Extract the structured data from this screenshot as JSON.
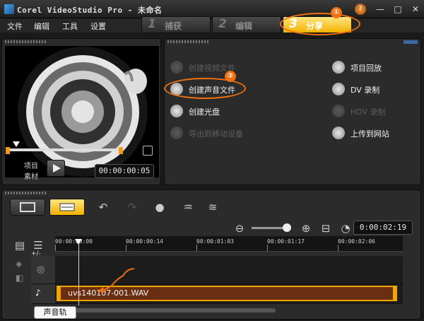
{
  "window": {
    "title": "Corel VideoStudio Pro - 未命名",
    "help_icon": "help-icon"
  },
  "menu": [
    "文件",
    "编辑",
    "工具",
    "设置"
  ],
  "steps": [
    {
      "num": "1",
      "label": "捕获"
    },
    {
      "num": "2",
      "label": "编辑"
    },
    {
      "num": "3",
      "label": "分享"
    }
  ],
  "annotations": {
    "badge1": "①",
    "badge2": "②"
  },
  "player": {
    "mode_project": "项目",
    "mode_clip": "素材",
    "timecode": "00:00:00:05"
  },
  "share": {
    "left": [
      {
        "label": "创建视频文件",
        "enabled": false,
        "icon": "film-reel-icon"
      },
      {
        "label": "创建声音文件",
        "enabled": true,
        "icon": "sound-file-icon"
      },
      {
        "label": "创建光盘",
        "enabled": true,
        "icon": "disc-icon"
      },
      {
        "label": "导出到移动设备",
        "enabled": false,
        "icon": "mobile-device-icon"
      }
    ],
    "right": [
      {
        "label": "项目回放",
        "enabled": true,
        "icon": "film-playback-icon"
      },
      {
        "label": "DV 录制",
        "enabled": true,
        "icon": "camcorder-icon"
      },
      {
        "label": "HDV 录制",
        "enabled": false,
        "icon": "hdv-camcorder-icon"
      },
      {
        "label": "上传到网站",
        "enabled": true,
        "icon": "globe-icon"
      }
    ]
  },
  "timeline": {
    "timecode": "0:00:02:19",
    "ruler": [
      "00:00:00:00",
      "00:00:00:14",
      "00:00:01:03",
      "00:00:01:17",
      "00:00:02:06"
    ],
    "clip_name": "uvs140107-001.WAV",
    "tooltip": "声音轨",
    "track_add_label": "+/-"
  },
  "colors": {
    "accent": "#f3b100",
    "annotation": "#f07010",
    "clip": "#6a2e12"
  }
}
